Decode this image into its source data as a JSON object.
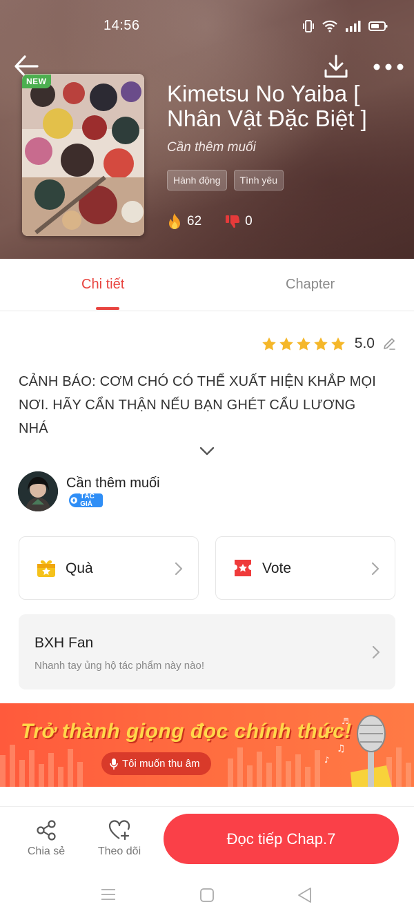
{
  "status_bar": {
    "time": "14:56"
  },
  "header": {
    "badge": "NEW",
    "title": "Kimetsu No Yaiba [ Nhân Vật Đặc Biệt ]",
    "author": "Cần thêm muối",
    "tags": [
      "Hành động",
      "Tình yêu"
    ],
    "likes": "62",
    "dislikes": "0"
  },
  "tabs": {
    "detail": "Chi tiết",
    "chapter": "Chapter"
  },
  "rating": {
    "score": "5.0"
  },
  "description": "CẢNH BÁO: CƠM CHÓ CÓ THỂ XUẤT HIỆN KHẮP MỌI NƠI. HÃY CẨN THẬN NẾU BẠN GHÉT CẨU LƯƠNG NHÁ",
  "author_info": {
    "name": "Cần thêm muối",
    "badge": "TÁC GIẢ"
  },
  "cards": {
    "gift": "Quà",
    "vote": "Vote"
  },
  "fan_ranking": {
    "title": "BXH Fan",
    "subtitle": "Nhanh tay ủng hộ tác phẩm này nào!"
  },
  "banner": {
    "slogan": "Trở thành giọng đọc chính thức!",
    "button": "Tôi muốn thu âm"
  },
  "bottom": {
    "share": "Chia sẻ",
    "follow": "Theo dõi",
    "read": "Đọc tiếp Chap.7"
  },
  "colors": {
    "accent": "#e8443f",
    "read_button": "#fa4048",
    "badge_new": "#4caf50",
    "author_badge": "#2f8ef6"
  }
}
